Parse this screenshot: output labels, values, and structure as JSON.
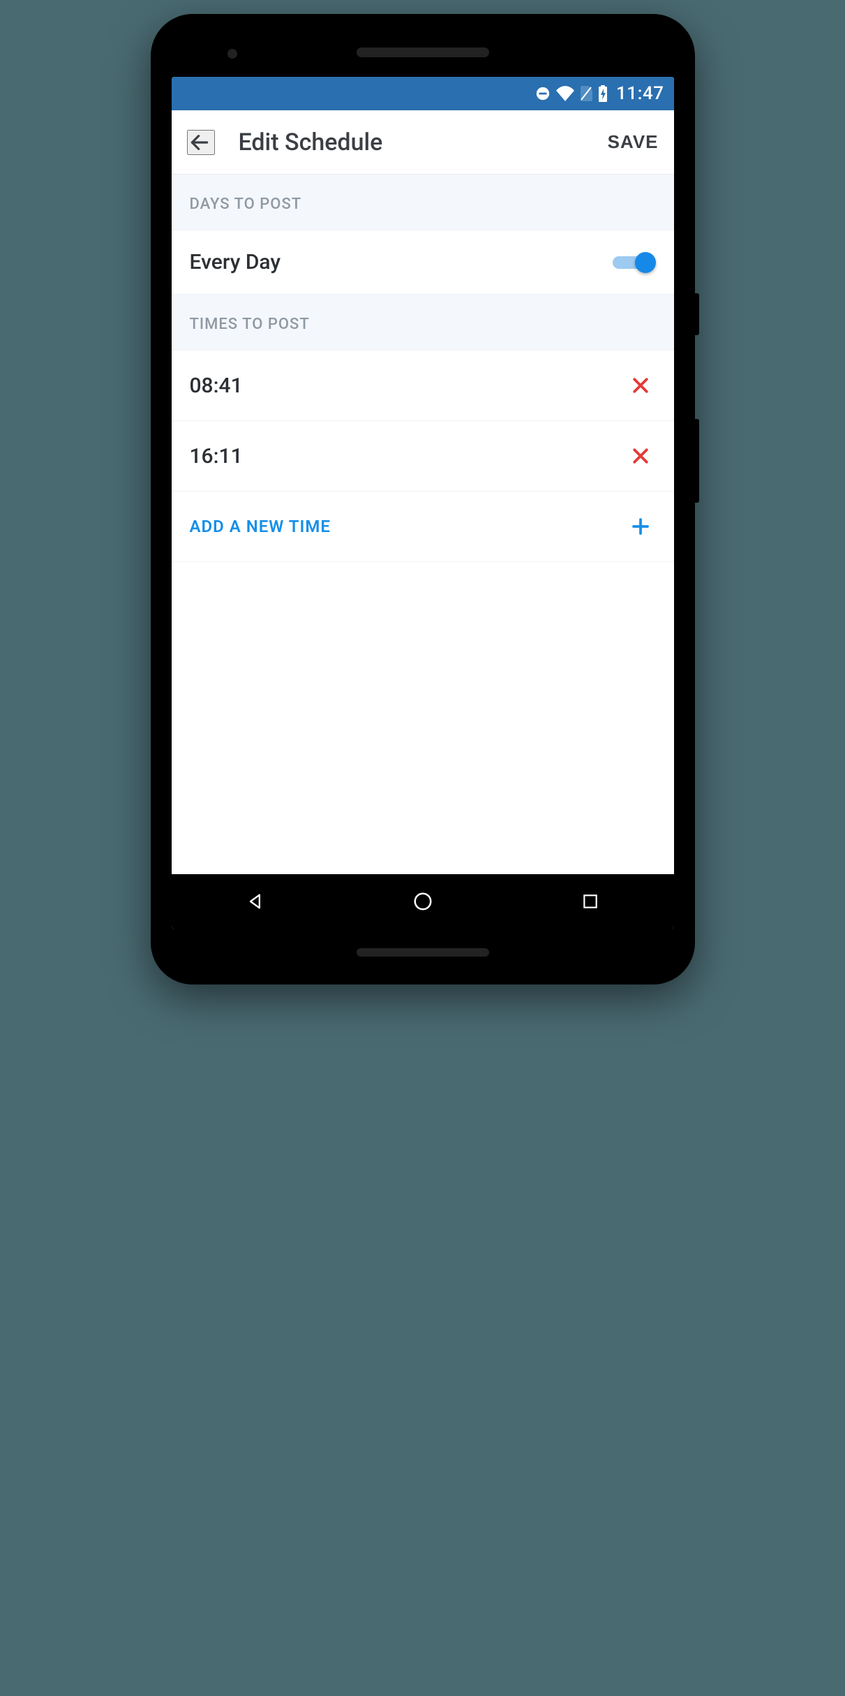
{
  "status": {
    "time": "11:47"
  },
  "appbar": {
    "title": "Edit Schedule",
    "save_label": "SAVE"
  },
  "sections": {
    "days_header": "DAYS TO POST",
    "every_day_label": "Every Day",
    "every_day_on": true,
    "times_header": "TIMES TO POST",
    "times": [
      {
        "value": "08:41"
      },
      {
        "value": "16:11"
      }
    ],
    "add_label": "ADD A NEW TIME"
  }
}
